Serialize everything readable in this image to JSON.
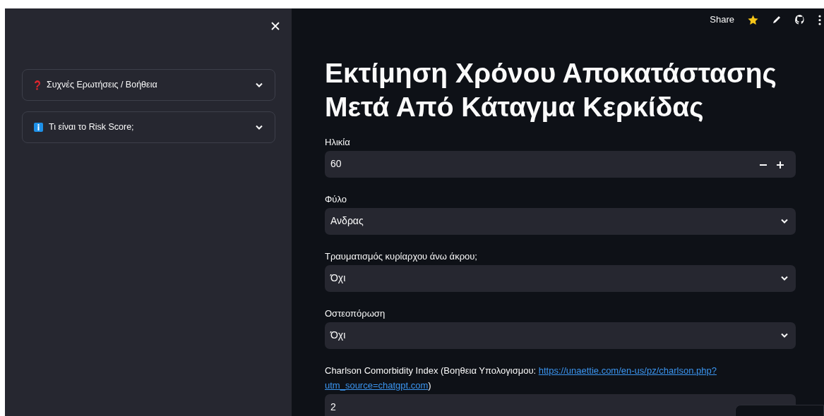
{
  "sidebar": {
    "expanders": [
      {
        "kind": "question",
        "label": "Συχνές Ερωτήσεις / Βοήθεια",
        "expanded": false
      },
      {
        "kind": "info",
        "label": "Τι είναι το Risk Score;",
        "expanded": false
      }
    ]
  },
  "toolbar": {
    "share": "Share"
  },
  "title": "Εκτίμηση Χρόνου Αποκατάστασης Μετά Από Κάταγμα Κερκίδας",
  "fields": [
    {
      "kind": "number",
      "label": "Ηλικία",
      "value": "60",
      "steppers": true
    },
    {
      "kind": "select",
      "label": "Φύλο",
      "value": "Ανδρας"
    },
    {
      "kind": "select",
      "label": "Τραυματισμός κυρίαρχου άνω άκρου;",
      "value": "Όχι"
    },
    {
      "kind": "select",
      "label": "Οστεοπόρωση",
      "value": "Όχι"
    },
    {
      "kind": "number",
      "label": "Charlson Comorbidity Index (Βοηθεια Υπολογισμου: ",
      "link": [
        "https://unaettie.com/en-us/pz/charlson.php?",
        "utm_source=chatgpt.com"
      ],
      "label_end": ")",
      "value": "2"
    }
  ]
}
